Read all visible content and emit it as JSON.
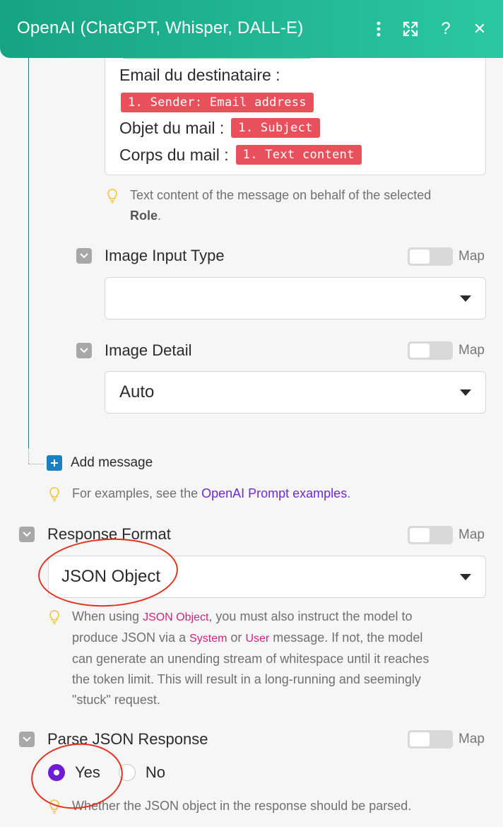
{
  "header": {
    "title": "OpenAI (ChatGPT, Whisper, DALL-E)",
    "icons": [
      "more-vertical-icon",
      "expand-icon",
      "help-icon",
      "close-icon"
    ],
    "help_label": "?",
    "close_label": "✕",
    "color_start": "#16a384",
    "color_end": "#2cc7a2"
  },
  "message": {
    "recipient_label": "Email du destinataire :",
    "recipient_token": "1. Sender: Email address",
    "subject_label": "Objet du mail :",
    "subject_token": "1. Subject",
    "body_label": "Corps du mail :",
    "body_token": "1. Text content",
    "hint_text": "Text content of the message on behalf of the selected ",
    "hint_bold": "Role",
    "hint_end": "."
  },
  "image_input_type": {
    "label": "Image Input Type",
    "map_label": "Map",
    "value": ""
  },
  "image_detail": {
    "label": "Image Detail",
    "map_label": "Map",
    "value": "Auto"
  },
  "add_message": {
    "label": "Add message"
  },
  "examples_hint": {
    "text": "For examples, see the ",
    "link": "OpenAI Prompt examples",
    "end": "."
  },
  "response_format": {
    "label": "Response Format",
    "map_label": "Map",
    "value": "JSON Object",
    "hint_line1_a": "When using ",
    "hint_token1": "JSON Object",
    "hint_line1_b": ", you must also instruct the model to",
    "hint_line2_a": "produce JSON via a ",
    "hint_token2": "System",
    "hint_line2_b": " or ",
    "hint_token3": "User",
    "hint_line2_c": " message. If not, the model",
    "hint_line3": "can generate an unending stream of whitespace until it reaches",
    "hint_line4": "the token limit. This will result in a long-running and seemingly",
    "hint_line5": "\"stuck\" request."
  },
  "parse_json": {
    "label": "Parse JSON Response",
    "map_label": "Map",
    "options": [
      "Yes",
      "No"
    ],
    "selected": "Yes",
    "hint": "Whether the JSON object in the response should be parsed."
  },
  "colors": {
    "accent": "#6d1bd6",
    "token": "#e8505b",
    "link": "#6d29d9",
    "annotation": "#e0331f"
  }
}
